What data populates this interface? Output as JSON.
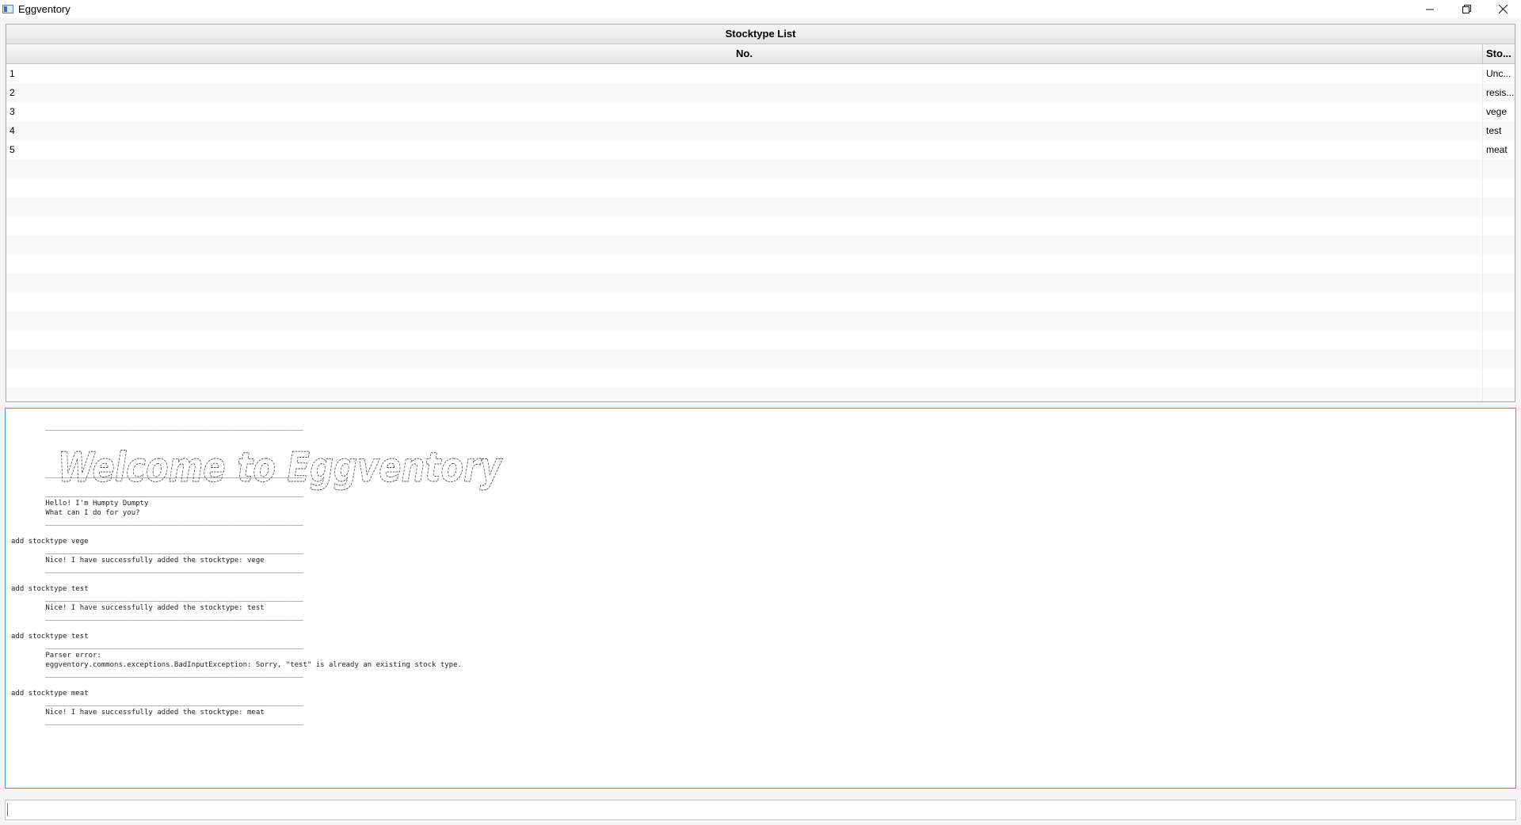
{
  "window": {
    "title": "Eggventory",
    "minimize_glyph": "—",
    "restore_glyph": "❐",
    "close_glyph": "✕"
  },
  "table": {
    "title": "Stocktype List",
    "columns": [
      "No.",
      "Sto..."
    ],
    "rows": [
      {
        "no": "1",
        "type": "Unc..."
      },
      {
        "no": "2",
        "type": "resis..."
      },
      {
        "no": "3",
        "type": "vege"
      },
      {
        "no": "4",
        "type": "test"
      },
      {
        "no": "5",
        "type": "meat"
      }
    ],
    "empty_rows": 13
  },
  "console": {
    "lines": [
      "        ____________________________________________________________",
      "",
      "",
      "",
      "",
      "        ____________________________________________________________",
      "",
      "        ____________________________________________________________",
      "        Hello! I'm Humpty Dumpty",
      "        What can I do for you?",
      "        ____________________________________________________________",
      "",
      "add stocktype vege",
      "        ____________________________________________________________",
      "        Nice! I have successfully added the stocktype: vege",
      "        ____________________________________________________________",
      "",
      "add stocktype test",
      "        ____________________________________________________________",
      "        Nice! I have successfully added the stocktype: test",
      "        ____________________________________________________________",
      "",
      "add stocktype test",
      "        ____________________________________________________________",
      "        Parser error:",
      "        eggventory.commons.exceptions.BadInputException: Sorry, \"test\" is already an existing stock type.",
      "        ____________________________________________________________",
      "",
      "add stocktype meat",
      "        ____________________________________________________________",
      "        Nice! I have successfully added the stocktype: meat",
      "        ____________________________________________________________"
    ],
    "banner_text": "Welcome to Eggventory"
  },
  "input": {
    "value": "",
    "placeholder": ""
  }
}
